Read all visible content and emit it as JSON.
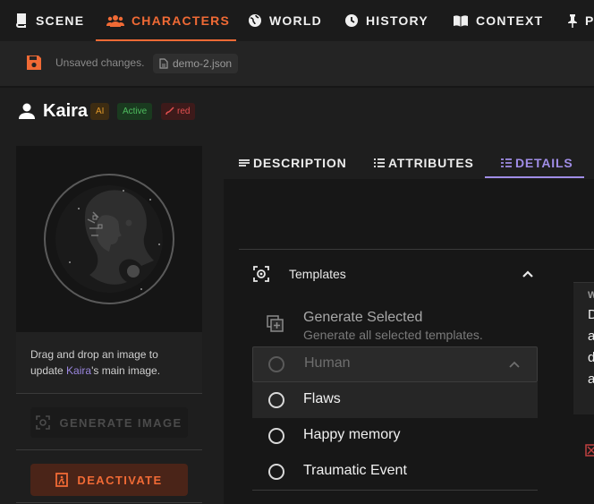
{
  "nav": {
    "items": [
      {
        "label": "SCENE",
        "icon": "scene-icon"
      },
      {
        "label": "CHARACTERS",
        "icon": "characters-icon",
        "active": true
      },
      {
        "label": "WORLD",
        "icon": "globe-icon"
      },
      {
        "label": "HISTORY",
        "icon": "clock-icon"
      },
      {
        "label": "CONTEXT",
        "icon": "book-icon"
      },
      {
        "label": "P",
        "icon": "pin-icon"
      }
    ],
    "accent": "#f06a35"
  },
  "subbar": {
    "unsaved": "Unsaved changes.",
    "file": "demo-2.json"
  },
  "character": {
    "name": "Kaira",
    "badges": {
      "ai": "AI",
      "active": "Active",
      "color": "red"
    },
    "image_hint_pre": "Drag and drop an image to update ",
    "image_hint_name": "Kaira",
    "image_hint_post": "'s main image."
  },
  "buttons": {
    "generate_image": "GENERATE IMAGE",
    "deactivate": "DEACTIVATE"
  },
  "tabs": [
    {
      "label": "DESCRIPTION",
      "icon": "description-icon"
    },
    {
      "label": "ATTRIBUTES",
      "icon": "list-icon"
    },
    {
      "label": "DETAILS",
      "icon": "details-icon",
      "active": true
    }
  ],
  "templates": {
    "title": "Templates",
    "generate_selected": "Generate Selected",
    "generate_selected_sub": "Generate all selected templates.",
    "group": "Human",
    "items": [
      "Flaws",
      "Happy memory",
      "Traumatic Event"
    ]
  },
  "side_card": {
    "heading": "W",
    "lines": [
      "D",
      "a",
      "d",
      "a"
    ]
  },
  "colors": {
    "tab_accent": "#a08de6",
    "deactivate_bg": "#4a2418"
  }
}
